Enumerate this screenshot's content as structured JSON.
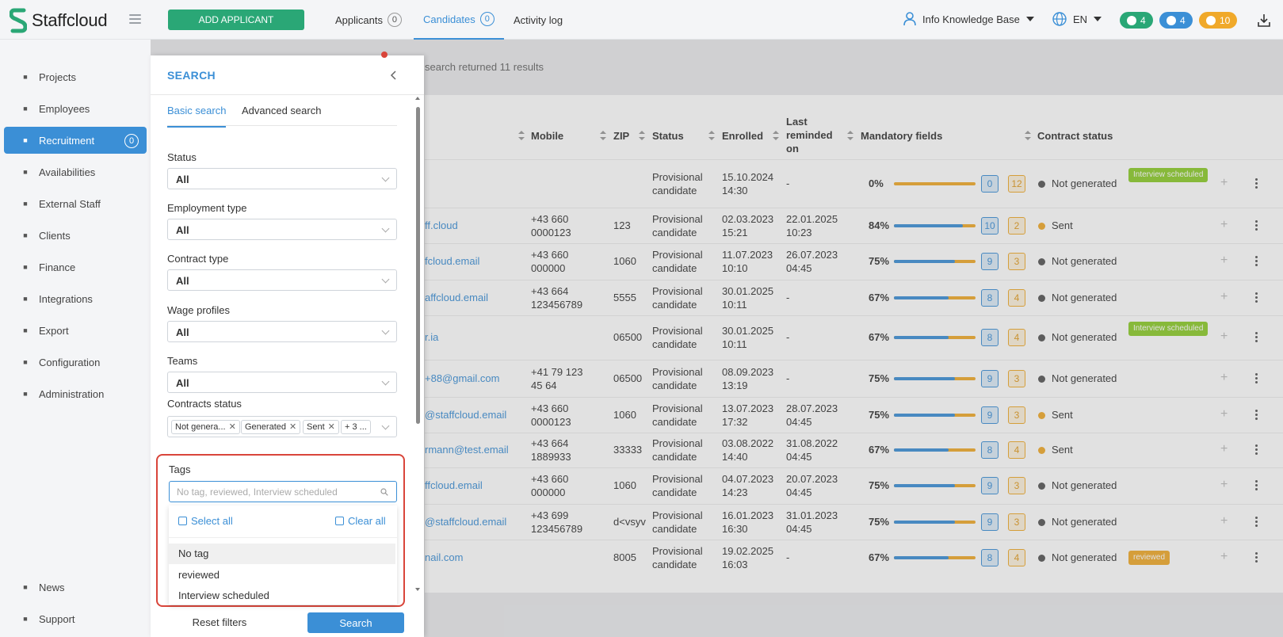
{
  "app": {
    "name": "Staffcloud"
  },
  "header": {
    "add_button": "ADD APPLICANT",
    "tabs": [
      {
        "label": "Applicants",
        "count": "0",
        "active": false
      },
      {
        "label": "Candidates",
        "count": "0",
        "active": true
      },
      {
        "label": "Activity log",
        "count": "",
        "active": false
      }
    ],
    "user_label": "Info Knowledge Base",
    "language": "EN",
    "pills": [
      {
        "icon": "chat-icon",
        "value": "4",
        "color": "#2aa776"
      },
      {
        "icon": "bell-icon",
        "value": "4",
        "color": "#3b8fd6"
      },
      {
        "icon": "clock-icon",
        "value": "10",
        "color": "#f0a92a"
      }
    ]
  },
  "sidebar": {
    "items": [
      {
        "label": "Projects",
        "icon": "sitemap-icon",
        "active": false
      },
      {
        "label": "Employees",
        "icon": "users-icon",
        "active": false
      },
      {
        "label": "Recruitment",
        "icon": "user-plus-icon",
        "active": true,
        "badge": "0"
      },
      {
        "label": "Availabilities",
        "icon": "calendar-check-icon",
        "active": false
      },
      {
        "label": "External Staff",
        "icon": "sign-in-icon",
        "active": false
      },
      {
        "label": "Clients",
        "icon": "building-icon",
        "active": false
      },
      {
        "label": "Finance",
        "icon": "money-icon",
        "active": false
      },
      {
        "label": "Integrations",
        "icon": "sync-icon",
        "active": false
      },
      {
        "label": "Export",
        "icon": "file-icon",
        "active": false
      },
      {
        "label": "Configuration",
        "icon": "gear-icon",
        "active": false
      },
      {
        "label": "Administration",
        "icon": "user-cog-icon",
        "active": false
      }
    ],
    "footer": [
      {
        "label": "News",
        "icon": "megaphone-icon"
      },
      {
        "label": "Support",
        "icon": "support-icon"
      }
    ]
  },
  "results": {
    "text": "search returned 11 results"
  },
  "table": {
    "headers": {
      "mobile": "Mobile",
      "zip": "ZIP",
      "status": "Status",
      "enrolled": "Enrolled",
      "last_reminded": "Last reminded on",
      "mandatory": "Mandatory fields",
      "contract": "Contract status"
    },
    "rows": [
      {
        "email": "",
        "mobile": "",
        "zip": "",
        "status": "Provisional candidate",
        "enrolled": "15.10.2024 14:30",
        "reminded": "-",
        "pct": "0%",
        "fill": 0,
        "filled": "0",
        "missing": "12",
        "contract": "Not generated",
        "contract_color": "#555",
        "tag": "Interview scheduled",
        "tag_color": "#8ccc2a"
      },
      {
        "email": "ff.cloud",
        "mobile": "+43 660 0000123",
        "zip": "123",
        "status": "Provisional candidate",
        "enrolled": "02.03.2023 15:21",
        "reminded": "22.01.2025 10:23",
        "pct": "84%",
        "fill": 0.84,
        "filled": "10",
        "missing": "2",
        "contract": "Sent",
        "contract_color": "#f0a92a",
        "tag": "",
        "tag_color": ""
      },
      {
        "email": "fcloud.email",
        "mobile": "+43 660 000000",
        "zip": "1060",
        "status": "Provisional candidate",
        "enrolled": "11.07.2023 10:10",
        "reminded": "26.07.2023 04:45",
        "pct": "75%",
        "fill": 0.75,
        "filled": "9",
        "missing": "3",
        "contract": "Not generated",
        "contract_color": "#555",
        "tag": "",
        "tag_color": ""
      },
      {
        "email": "affcloud.email",
        "mobile": "+43 664 123456789",
        "zip": "5555",
        "status": "Provisional candidate",
        "enrolled": "30.01.2025 10:11",
        "reminded": "-",
        "pct": "67%",
        "fill": 0.67,
        "filled": "8",
        "missing": "4",
        "contract": "Not generated",
        "contract_color": "#555",
        "tag": "",
        "tag_color": ""
      },
      {
        "email": "r.ia",
        "mobile": "",
        "zip": "06500",
        "status": "Provisional candidate",
        "enrolled": "30.01.2025 10:11",
        "reminded": "-",
        "pct": "67%",
        "fill": 0.67,
        "filled": "8",
        "missing": "4",
        "contract": "Not generated",
        "contract_color": "#555",
        "tag": "Interview scheduled",
        "tag_color": "#8ccc2a"
      },
      {
        "email": "+88@gmail.com",
        "mobile": "+41 79 123 45 64",
        "zip": "06500",
        "status": "Provisional candidate",
        "enrolled": "08.09.2023 13:19",
        "reminded": "-",
        "pct": "75%",
        "fill": 0.75,
        "filled": "9",
        "missing": "3",
        "contract": "Not generated",
        "contract_color": "#555",
        "tag": "",
        "tag_color": ""
      },
      {
        "email": "@staffcloud.email",
        "mobile": "+43 660 0000123",
        "zip": "1060",
        "status": "Provisional candidate",
        "enrolled": "13.07.2023 17:32",
        "reminded": "28.07.2023 04:45",
        "pct": "75%",
        "fill": 0.75,
        "filled": "9",
        "missing": "3",
        "contract": "Sent",
        "contract_color": "#f0a92a",
        "tag": "",
        "tag_color": ""
      },
      {
        "email": "rmann@test.email",
        "mobile": "+43 664 1889933",
        "zip": "33333",
        "status": "Provisional candidate",
        "enrolled": "03.08.2022 14:40",
        "reminded": "31.08.2022 04:45",
        "pct": "67%",
        "fill": 0.67,
        "filled": "8",
        "missing": "4",
        "contract": "Sent",
        "contract_color": "#f0a92a",
        "tag": "",
        "tag_color": ""
      },
      {
        "email": "ffcloud.email",
        "mobile": "+43 660 000000",
        "zip": "1060",
        "status": "Provisional candidate",
        "enrolled": "04.07.2023 14:23",
        "reminded": "20.07.2023 04:45",
        "pct": "75%",
        "fill": 0.75,
        "filled": "9",
        "missing": "3",
        "contract": "Not generated",
        "contract_color": "#555",
        "tag": "",
        "tag_color": ""
      },
      {
        "email": "@staffcloud.email",
        "mobile": "+43 699 123456789",
        "zip": "d<vsyv",
        "status": "Provisional candidate",
        "enrolled": "16.01.2023 16:30",
        "reminded": "31.01.2023 04:45",
        "pct": "75%",
        "fill": 0.75,
        "filled": "9",
        "missing": "3",
        "contract": "Not generated",
        "contract_color": "#555",
        "tag": "",
        "tag_color": ""
      },
      {
        "email": "nail.com",
        "mobile": "",
        "zip": "8005",
        "status": "Provisional candidate",
        "enrolled": "19.02.2025 16:03",
        "reminded": "-",
        "pct": "67%",
        "fill": 0.67,
        "filled": "8",
        "missing": "4",
        "contract": "Not generated",
        "contract_color": "#555",
        "tag": "reviewed",
        "tag_color": "#f0a92a"
      }
    ]
  },
  "search_panel": {
    "title": "SEARCH",
    "tabs": [
      "Basic search",
      "Advanced search"
    ],
    "fields": [
      {
        "label": "Status",
        "value": "All"
      },
      {
        "label": "Employment type",
        "value": "All"
      },
      {
        "label": "Contract type",
        "value": "All"
      },
      {
        "label": "Wage profiles",
        "value": "All"
      },
      {
        "label": "Teams",
        "value": "All"
      }
    ],
    "contracts_status": {
      "label": "Contracts status",
      "chips": [
        "Not genera...",
        "Generated",
        "Sent",
        "+ 3 ..."
      ]
    },
    "tags": {
      "label": "Tags",
      "placeholder": "No tag, reviewed, Interview scheduled",
      "select_all": "Select all",
      "clear_all": "Clear all",
      "options": [
        "No tag",
        "reviewed",
        "Interview scheduled"
      ]
    },
    "reset_label": "Reset filters",
    "search_label": "Search"
  }
}
